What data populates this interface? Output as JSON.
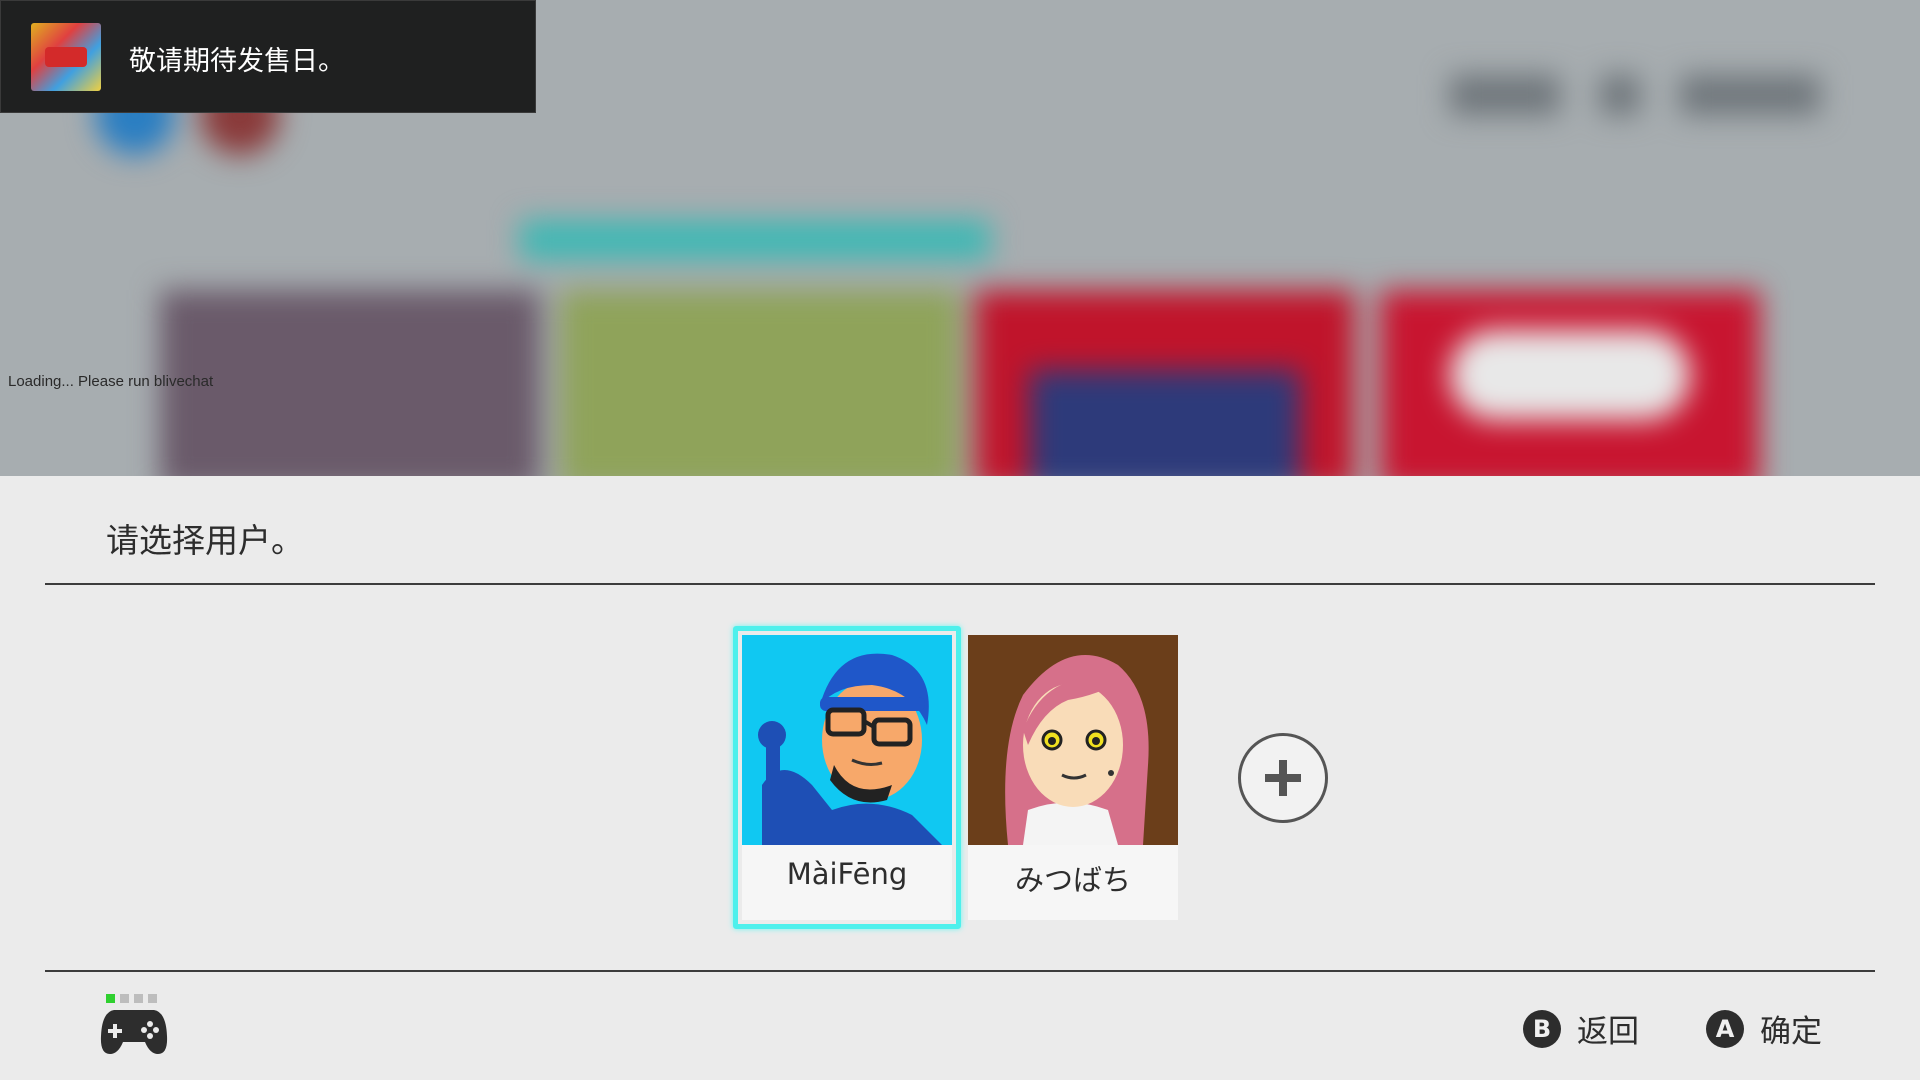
{
  "notification": {
    "text": "敬请期待发售日。",
    "icon": "game-cover-icon"
  },
  "overlay": {
    "loading_text": "Loading... Please run blivechat"
  },
  "user_select": {
    "title": "请选择用户。",
    "users": [
      {
        "name": "MàiFēng",
        "selected": true
      },
      {
        "name": "みつばち",
        "selected": false
      }
    ],
    "add_user_icon": "plus-circle-icon"
  },
  "footer": {
    "controller_players": [
      true,
      false,
      false,
      false
    ],
    "controller_icon": "gamepad-icon",
    "buttons": [
      {
        "key": "B",
        "label": "返回"
      },
      {
        "key": "A",
        "label": "确定"
      }
    ]
  },
  "colors": {
    "selection_accent": "#4ef0ec",
    "player_indicator": "#2fd02f"
  }
}
